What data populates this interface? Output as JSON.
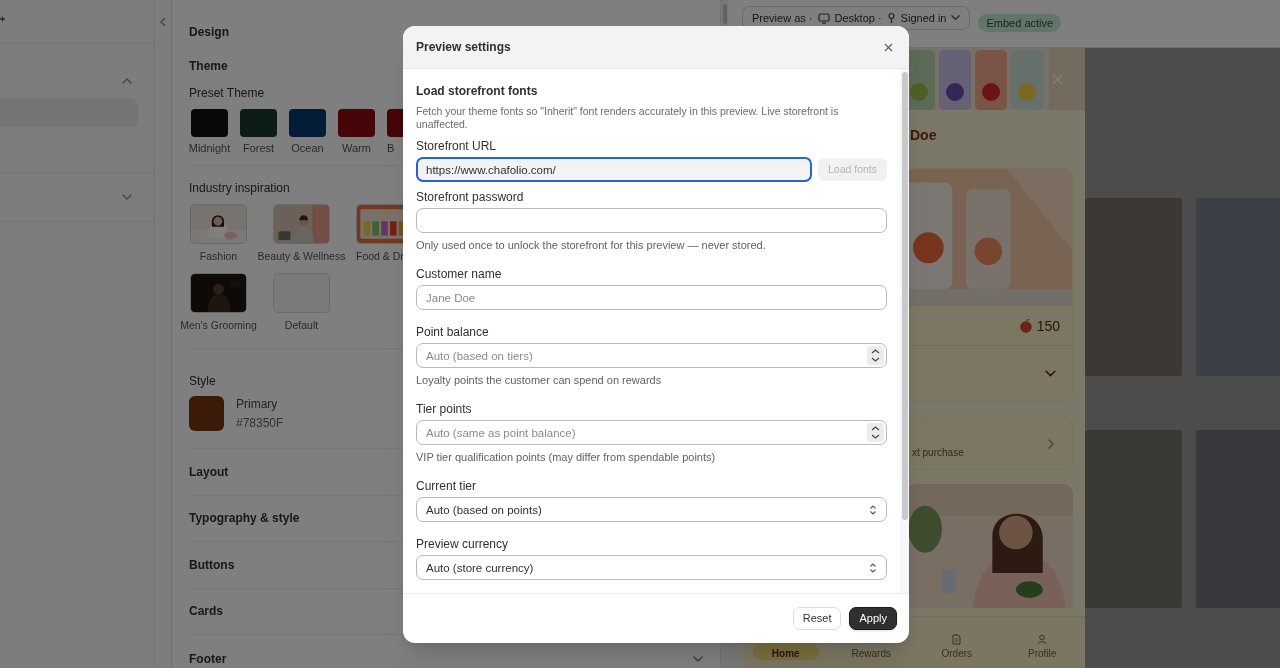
{
  "rail": {
    "sections": [
      {
        "expanded": true
      },
      {
        "expanded": false
      }
    ]
  },
  "design": {
    "title": "Design",
    "theme_heading": "Theme",
    "preset_label": "Preset Theme",
    "presets": [
      {
        "label": "Midnight",
        "color": "#0a0808"
      },
      {
        "label": "Forest",
        "color": "#0c1d17"
      },
      {
        "label": "Ocean",
        "color": "#031c37"
      },
      {
        "label": "Warm",
        "color": "#450509"
      },
      {
        "label": "B",
        "color": "#450509"
      }
    ],
    "industry_label": "Industry inspiration",
    "industries": [
      {
        "label": "Fashion",
        "kind": "picture"
      },
      {
        "label": "Beauty & Wellness",
        "kind": "picture"
      },
      {
        "label": "Food & Dr",
        "kind": "picture"
      },
      {
        "label": "Men's Grooming",
        "kind": "picture"
      },
      {
        "label": "Default",
        "kind": "blank"
      }
    ],
    "style_heading": "Style",
    "primary": {
      "label": "Primary",
      "value": "#78350F",
      "color": "#3c1a08"
    },
    "sections": [
      {
        "label": "Layout"
      },
      {
        "label": "Typography & style"
      },
      {
        "label": "Buttons"
      },
      {
        "label": "Cards"
      },
      {
        "label": "Footer"
      }
    ]
  },
  "preview_bar": {
    "label": "Preview as ·",
    "device": "Desktop ·",
    "session": "Signed in",
    "badge": "Embed active"
  },
  "storefront": {
    "greeting": "Doe",
    "points": "150",
    "offer_text": "xt purchase",
    "nav": [
      {
        "label": "Home",
        "selected": true
      },
      {
        "label": "Rewards",
        "selected": false
      },
      {
        "label": "Orders",
        "selected": false
      },
      {
        "label": "Profile",
        "selected": false
      }
    ]
  },
  "modal": {
    "title": "Preview settings",
    "section_title": "Load storefront fonts",
    "description": "Fetch your theme fonts so \"Inherit\" font renders accurately in this preview. Live storefront is unaffected.",
    "fields": [
      {
        "kind": "url",
        "label": "Storefront URL",
        "value": "https://www.chafolio.com/",
        "focused": true,
        "button": {
          "label": "Load fonts",
          "disabled": true
        }
      },
      {
        "kind": "password",
        "label": "Storefront password",
        "focused": false,
        "help": "Only used once to unlock the storefront for this preview — never stored."
      },
      {
        "kind": "text",
        "label": "Customer name",
        "placeholder": "Jane Doe",
        "focused": false
      },
      {
        "kind": "number",
        "label": "Point balance",
        "placeholder": "Auto (based on tiers)",
        "focused": false,
        "help": "Loyalty points the customer can spend on rewards"
      },
      {
        "kind": "number",
        "label": "Tier points",
        "placeholder": "Auto (same as point balance)",
        "focused": false,
        "help": "VIP tier qualification points (may differ from spendable points)"
      },
      {
        "kind": "select",
        "label": "Current tier",
        "value": "Auto (based on points)",
        "focused": false
      },
      {
        "kind": "select",
        "label": "Preview currency",
        "value": "Auto (store currency)",
        "focused": false
      }
    ],
    "buttons": [
      {
        "label": "Reset",
        "kind": "secondary"
      },
      {
        "label": "Apply",
        "kind": "primary"
      }
    ]
  }
}
